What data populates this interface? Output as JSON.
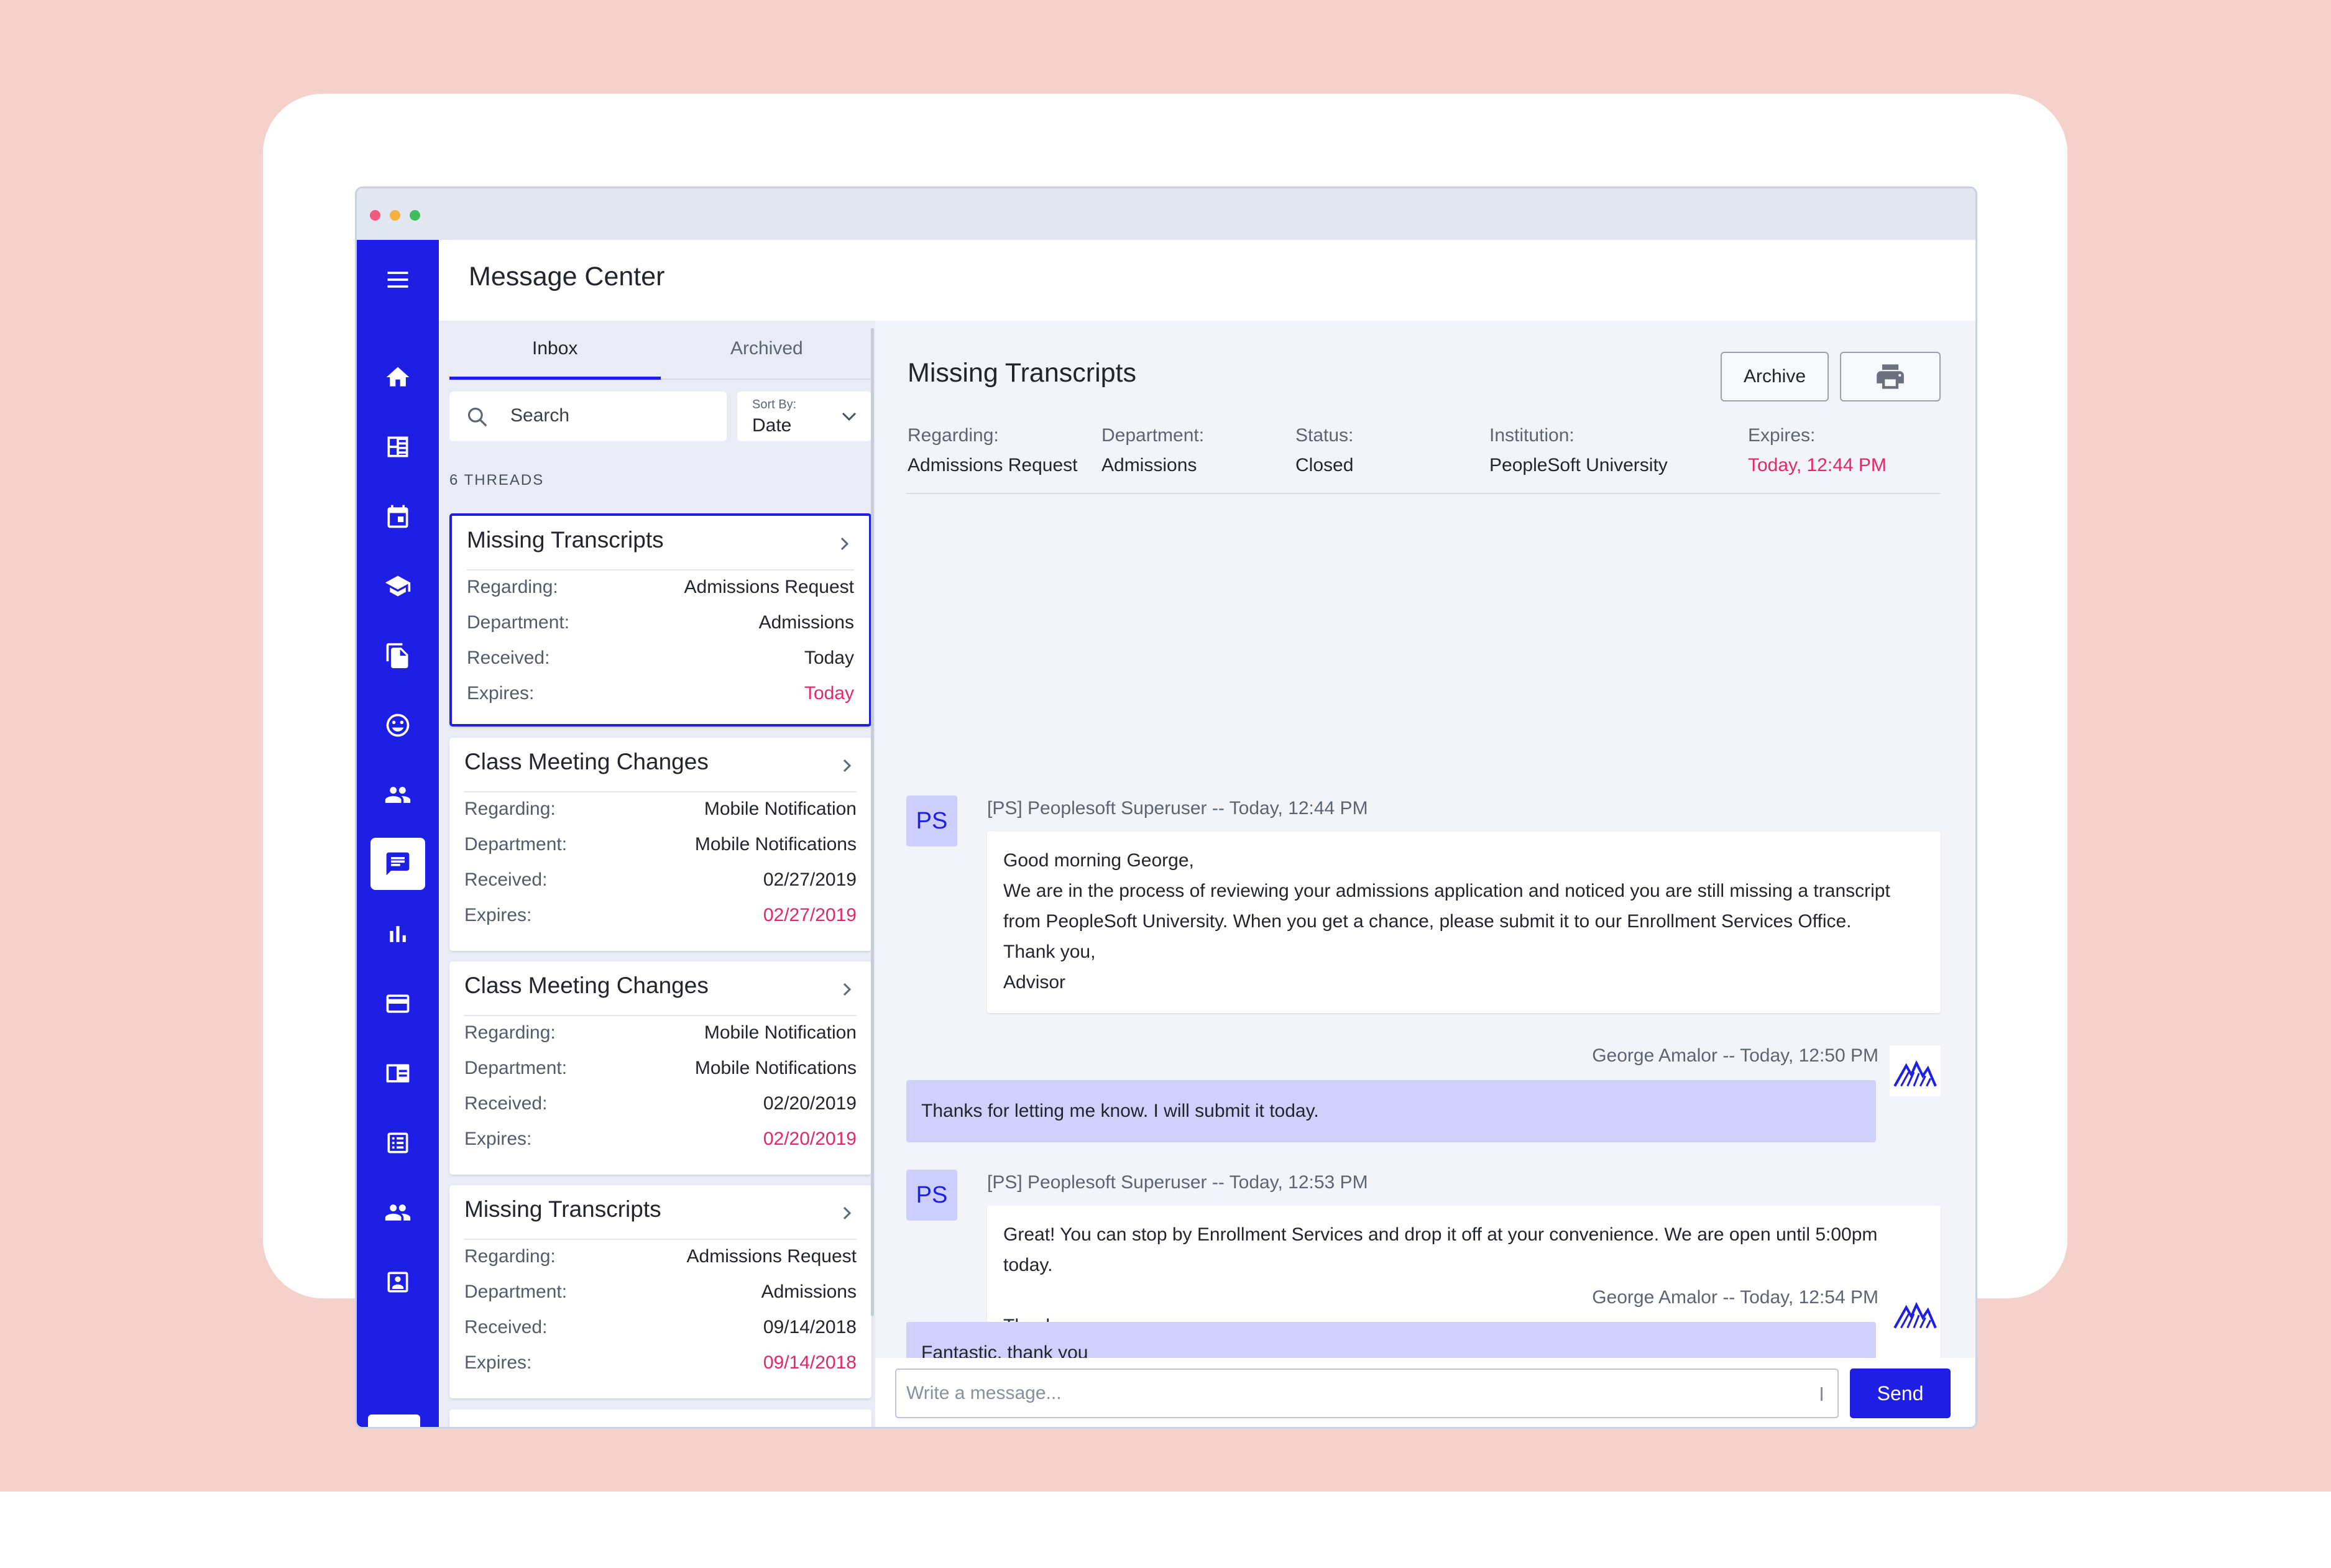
{
  "app": {
    "title": "Message Center"
  },
  "colors": {
    "accent": "#1f1ee4",
    "expires_red": "#e8246a",
    "reply_bubble": "#cfd0fb",
    "window_dots": [
      "#f05a7e",
      "#f5b040",
      "#3fbf5b"
    ]
  },
  "sidebar": {
    "menu_icon": "hamburger-menu-icon",
    "items": [
      {
        "icon": "home-icon"
      },
      {
        "icon": "dashboard-icon"
      },
      {
        "icon": "calendar-icon"
      },
      {
        "icon": "graduation-cap-icon"
      },
      {
        "icon": "documents-icon"
      },
      {
        "icon": "smiley-face-icon"
      },
      {
        "icon": "people-icon"
      },
      {
        "icon": "chat-message-icon",
        "active": true
      },
      {
        "icon": "bar-chart-icon"
      },
      {
        "icon": "credit-card-icon"
      },
      {
        "icon": "id-card-icon"
      },
      {
        "icon": "list-icon"
      },
      {
        "icon": "people-group-icon"
      },
      {
        "icon": "contact-card-icon"
      }
    ],
    "logo_icon": "institution-logo-icon"
  },
  "list": {
    "tabs": [
      {
        "label": "Inbox",
        "active": true
      },
      {
        "label": "Archived",
        "active": false
      }
    ],
    "search": {
      "placeholder": "Search"
    },
    "sort": {
      "label": "Sort By:",
      "value": "Date"
    },
    "threads_count": "6 THREADS",
    "field_labels": {
      "regarding": "Regarding:",
      "department": "Department:",
      "received": "Received:",
      "expires": "Expires:"
    },
    "threads": [
      {
        "title": "Missing Transcripts",
        "regarding": "Admissions Request",
        "department": "Admissions",
        "received": "Today",
        "expires": "Today",
        "selected": true
      },
      {
        "title": "Class Meeting Changes",
        "regarding": "Mobile Notification",
        "department": "Mobile Notifications",
        "received": "02/27/2019",
        "expires": "02/27/2019"
      },
      {
        "title": "Class Meeting Changes",
        "regarding": "Mobile Notification",
        "department": "Mobile Notifications",
        "received": "02/20/2019",
        "expires": "02/20/2019"
      },
      {
        "title": "Missing Transcripts",
        "regarding": "Admissions Request",
        "department": "Admissions",
        "received": "09/14/2018",
        "expires": "09/14/2018"
      }
    ]
  },
  "detail": {
    "title": "Missing Transcripts",
    "archive_label": "Archive",
    "print_icon": "printer-icon",
    "meta": {
      "regarding_label": "Regarding:",
      "regarding": "Admissions Request",
      "department_label": "Department:",
      "department": "Admissions",
      "status_label": "Status:",
      "status": "Closed",
      "institution_label": "Institution:",
      "institution": "PeopleSoft University",
      "expires_label": "Expires:",
      "expires": "Today, 12:44 PM"
    },
    "messages": [
      {
        "avatar": "PS",
        "header": "[PS] Peoplesoft Superuser -- Today, 12:44 PM",
        "body": "Good morning George,\nWe are in the process of reviewing your admissions application and noticed you are still missing a transcript\nfrom PeopleSoft University. When you get a chance, please submit it to our Enrollment Services Office.\nThank you,\nAdvisor"
      },
      {
        "header": "George Amalor -- Today, 12:50 PM",
        "body": "Thanks for letting me know. I will submit it today."
      },
      {
        "avatar": "PS",
        "header": "[PS] Peoplesoft Superuser -- Today, 12:53 PM",
        "body": "Great! You can stop by Enrollment Services and drop it off at your convenience. We are open until 5:00pm\ntoday.\n\nThank you,\nAdvisor"
      },
      {
        "header": "George Amalor -- Today, 12:54 PM",
        "body": "Fantastic, thank you"
      }
    ],
    "compose": {
      "placeholder": "Write a message...",
      "send_label": "Send"
    }
  }
}
